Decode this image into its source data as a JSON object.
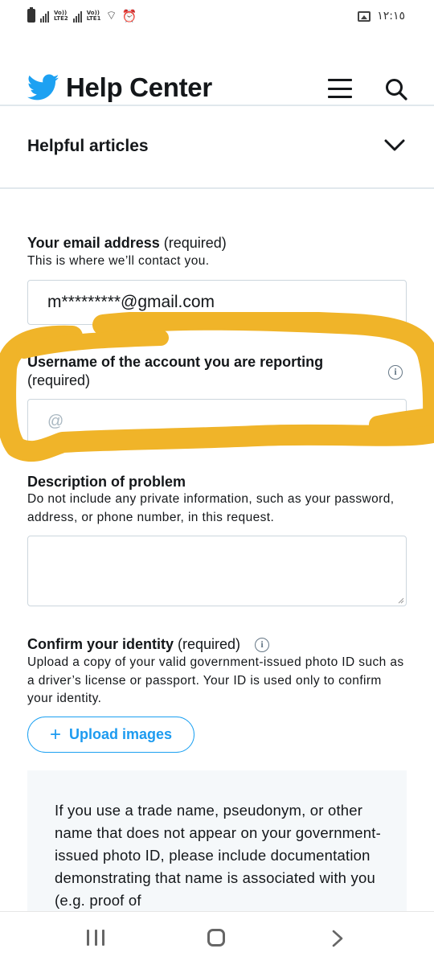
{
  "status_bar": {
    "net1": "Vo))",
    "net1_sub": "LTE2",
    "net2": "Vo))",
    "net2_sub": "LTE1",
    "wifi_glyph": "⌔",
    "alarm_glyph": "⏰",
    "time": "١٢:١٥",
    "icons": [
      "battery-icon",
      "signal-icon",
      "wifi-icon",
      "alarm-icon",
      "gallery-icon"
    ]
  },
  "header": {
    "title": "Help Center",
    "brand_color": "#1da1f2",
    "icons": [
      "twitter-bird-icon",
      "hamburger-menu-icon",
      "search-icon"
    ]
  },
  "helpful_articles": {
    "label": "Helpful articles",
    "icon": "chevron-down-icon"
  },
  "form": {
    "email": {
      "label_bold": "Your email address",
      "label_suffix": " (required)",
      "help": "This is where we’ll contact you.",
      "value": "m*********@gmail.com"
    },
    "username": {
      "label_bold": "Username of the account you are reporting",
      "label_suffix": "(required)",
      "placeholder": "@",
      "info_glyph": "i"
    },
    "description": {
      "label_bold": "Description of problem",
      "help": "Do not include any private information, such as your password, address, or phone number, in this request.",
      "value": ""
    },
    "identity": {
      "label_bold": "Confirm your identity",
      "label_suffix": " (required)",
      "info_glyph": "i",
      "help": "Upload a copy of your valid government-issued photo ID such as a driver’s license or passport. Your ID is used only to confirm your identity."
    },
    "upload_button": {
      "plus": "+",
      "label": "Upload images",
      "color": "#1d9bf0"
    },
    "note": "If you use a trade name, pseudonym, or other name that does not appear on your government-issued photo ID, please include documentation demonstrating that name is associated with you (e.g. proof of"
  },
  "annotation": {
    "highlight_color": "#f0b429"
  },
  "nav_bar": {
    "icons": [
      "recent-apps-icon",
      "home-icon",
      "back-icon"
    ]
  }
}
